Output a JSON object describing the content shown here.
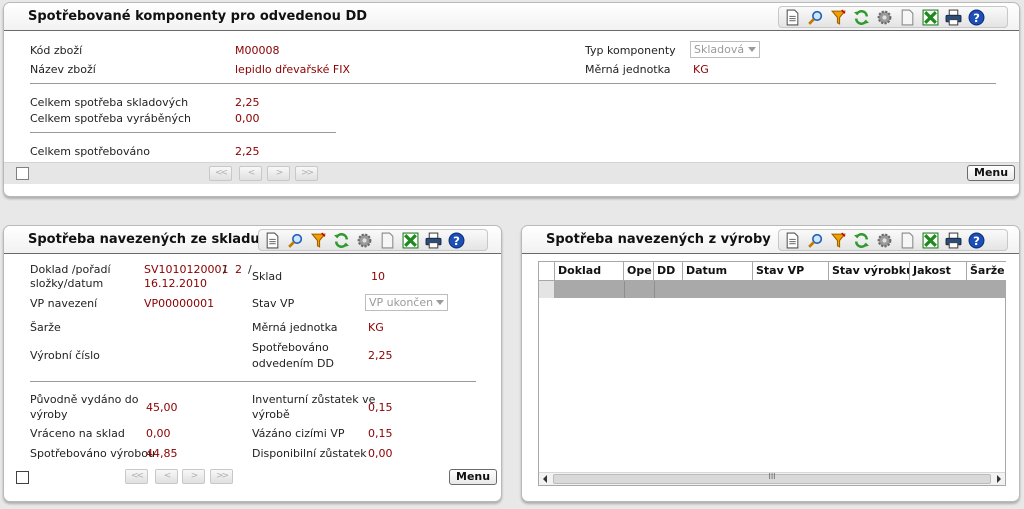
{
  "top_panel": {
    "title": "Spotřebované komponenty pro odvedenou DD",
    "fields": {
      "kod_zbozi_label": "Kód zboží",
      "kod_zbozi_value": "M00008",
      "nazev_zbozi_label": "Název zboží",
      "nazev_zbozi_value": "lepidlo dřevařské FIX",
      "typ_komponenty_label": "Typ komponenty",
      "typ_komponenty_value": "Skladová",
      "merna_jednotka_label": "Měrná jednotka",
      "merna_jednotka_value": "KG",
      "celkem_skladovych_label": "Celkem spotřeba skladových",
      "celkem_skladovych_value": "2,25",
      "celkem_vyrabenych_label": "Celkem spotřeba vyráběných",
      "celkem_vyrabenych_value": "0,00",
      "celkem_spotrebovano_label": "Celkem spotřebováno",
      "celkem_spotrebovano_value": "2,25"
    },
    "menu_label": "Menu",
    "nav": [
      "<<",
      "<",
      ">",
      ">>"
    ]
  },
  "left_panel": {
    "title": "Spotřeba navezených ze skladu",
    "fields": {
      "doklad_label_1": "Doklad /pořadí",
      "doklad_label_2": "složky/datum",
      "doklad_value_1": "SV1010120001",
      "doklad_sep_1": "/",
      "doklad_value_2": "2",
      "doklad_sep_2": "/",
      "doklad_value_3": "16.12.2010",
      "sklad_label": "Sklad",
      "sklad_value": "10",
      "vp_navezeni_label": "VP navezení",
      "vp_navezeni_value": "VP00000001",
      "stav_vp_label": "Stav VP",
      "stav_vp_value": "VP ukončen",
      "sarze_label": "Šarže",
      "merna_jednotka_label": "Měrná jednotka",
      "merna_jednotka_value": "KG",
      "vyrobni_cislo_label": "Výrobní číslo",
      "spotrebovano_dd_label_1": "Spotřebováno",
      "spotrebovano_dd_label_2": "odvedením DD",
      "spotrebovano_dd_value": "2,25",
      "puvodne_vydano_label_1": "Původně vydáno do",
      "puvodne_vydano_label_2": "výroby",
      "puvodne_vydano_value": "45,00",
      "inventurni_label_1": "Inventurní zůstatek ve",
      "inventurni_label_2": "výrobě",
      "inventurni_value": "0,15",
      "vraceno_label": "Vráceno na sklad",
      "vraceno_value": "0,00",
      "vazano_label": "Vázáno cizími VP",
      "vazano_value": "0,15",
      "spotrebovano_vyrobou_label": "Spotřebováno výrobou",
      "spotrebovano_vyrobou_value": "44,85",
      "disponibilni_label": "Disponibilní zůstatek",
      "disponibilni_value": "0,00"
    },
    "menu_label": "Menu",
    "nav": [
      "<<",
      "<",
      ">",
      ">>"
    ]
  },
  "right_panel": {
    "title": "Spotřeba navezených z výroby",
    "columns": [
      "Doklad",
      "Ope",
      "DD",
      "Datum",
      "Stav VP",
      "Stav výrobku",
      "Jakost",
      "Šarže"
    ],
    "scroll_grip": "III"
  },
  "toolbar_icons": [
    "new-document-icon",
    "search-icon",
    "filter-icon",
    "refresh-icon",
    "settings-icon",
    "blank-document-icon",
    "excel-export-icon",
    "print-icon",
    "help-icon"
  ],
  "colors": {
    "value_text": "#8b0000",
    "background": "#e8e8e8",
    "selected_row": "#a9a9a9"
  }
}
